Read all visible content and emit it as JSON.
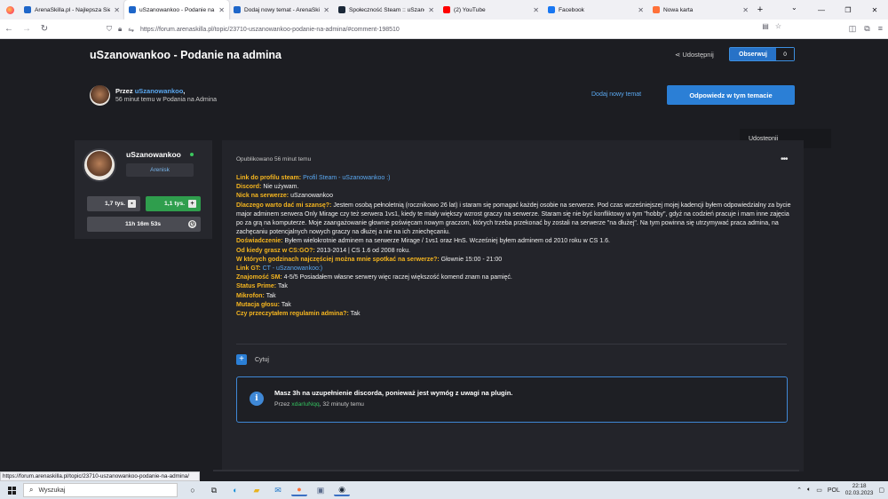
{
  "browser": {
    "tabs": [
      {
        "title": "ArenaSkilla.pl - Najlepsza Sieć S",
        "favicon_color": "#1e66c9",
        "active": false
      },
      {
        "title": "uSzanowankoo - Podanie na ad",
        "favicon_color": "#1e66c9",
        "active": true
      },
      {
        "title": "Dodaj nowy temat - ArenaSkilla",
        "favicon_color": "#1e66c9",
        "active": false
      },
      {
        "title": "Społeczność Steam :: uSzanowa",
        "favicon_color": "#1b2838",
        "active": false
      },
      {
        "title": "(2) YouTube",
        "favicon_color": "#ff0000",
        "active": false
      },
      {
        "title": "Facebook",
        "favicon_color": "#1877f2",
        "active": false
      },
      {
        "title": "Nowa karta",
        "favicon_color": "#ff7139",
        "active": false
      }
    ],
    "url": "https://forum.arenaskilla.pl/topic/23710-uszanowankoo-podanie-na-admina/#comment-198510",
    "status_url": "https://forum.arenaskilla.pl/topic/23710-uszanowankoo-podanie-na-admina/"
  },
  "topic": {
    "title": "uSzanowankoo - Podanie na admina",
    "share_label": "Udostępnij",
    "follow_label": "Obserwuj",
    "follow_count": "0",
    "by_prefix": "Przez",
    "author": "uSzanowankoo",
    "author_suffix": ",",
    "posted_meta": "56 minut temu w Podania na Admina",
    "add_topic_label": "Dodaj nowy temat",
    "reply_label": "Odpowiedz w tym temacie",
    "share_popup_label": "Udostępnij"
  },
  "user": {
    "name": "uSzanowankoo",
    "rank": "Arenisk",
    "stat_posts": "1,7 tys.",
    "stat_rep": "1,1 tys.",
    "stat_time": "11h 16m 53s"
  },
  "post": {
    "date": "Opublikowano 56 minut temu",
    "fields": [
      {
        "k": "Link do profilu steam:",
        "v": "",
        "link": " Profil Steam - uSzanowankoo :)"
      },
      {
        "k": "Discord:",
        "v": " Nie używam."
      },
      {
        "k": "Nick na serwerze:",
        "v": " uSzanowankoo"
      },
      {
        "k": "Dlaczego warto dać mi szansę?:",
        "v": " Jestem osobą pełnoletnią (rocznikowo 26 lat) i staram się pomagać każdej osobie na serwerze. Pod czas wcześniejszej mojej kadencji byłem odpowiedzialny za bycie major adminem serwera Only Mirage czy też serwera 1vs1, kiedy te miały większy wzrost graczy na serwerze. Staram się nie być konfliktowy w tym \"hobby\", gdyż na codzień pracuje i mam inne zajęcia po za grą na komputerze. Moje zaangażowanie głownie poświęcam nowym graczom, których trzeba przekonać by zostali na serwerze \"na dłużej\". Na tym powinna się utrzymywać praca admina, na zachęcaniu potencjalnych nowych graczy na dłużej a nie na ich zniechęcaniu."
      },
      {
        "k": "Doświadczenie:",
        "v": " Byłem wielokrotnie adminem na serwerze Mirage / 1vs1 oraz HnS. Wcześniej byłem adminem od 2010 roku w CS 1.6."
      },
      {
        "k": "Od kiedy grasz w CS:GO?:",
        "v": " 2013-2014 | CS 1.6 od 2008 roku."
      },
      {
        "k": "W których godzinach najczęściej można mnie spotkać na serwerze?:",
        "v": " Głownie 15:00 - 21:00"
      },
      {
        "k": "Link GT:",
        "v": "",
        "link": " CT - uSzanowankoo:)"
      },
      {
        "k": "Znajomość SM:",
        "v": " 4-5/5 Posiadałem własne serwery więc raczej większość komend znam na pamięć."
      },
      {
        "k": "Status Prime:",
        "v": " Tak"
      },
      {
        "k": "Mikrofon:",
        "v": " Tak"
      },
      {
        "k": "Mutacja głosu:",
        "v": " Tak"
      },
      {
        "k": "Czy przeczytałem regulamin admina?:",
        "v": " Tak"
      }
    ],
    "quote_label": "Cytuj",
    "note_title": "Masz 3h na uzupełnienie discorda, ponieważ jest wymóg z uwagi na plugin.",
    "note_by_prefix": "Przez",
    "note_author": "xdarIuNqq",
    "note_time": ", 32 minuty temu"
  },
  "taskbar": {
    "search_placeholder": "Wyszukaj",
    "lang": "POL",
    "time": "22:18",
    "date": "02.03.2023"
  },
  "colors": {
    "accent": "#2b7fd6",
    "link": "#5aa8f0",
    "field_key": "#f5b51f",
    "online": "#3cc75e",
    "rep": "#2f9e4d"
  }
}
